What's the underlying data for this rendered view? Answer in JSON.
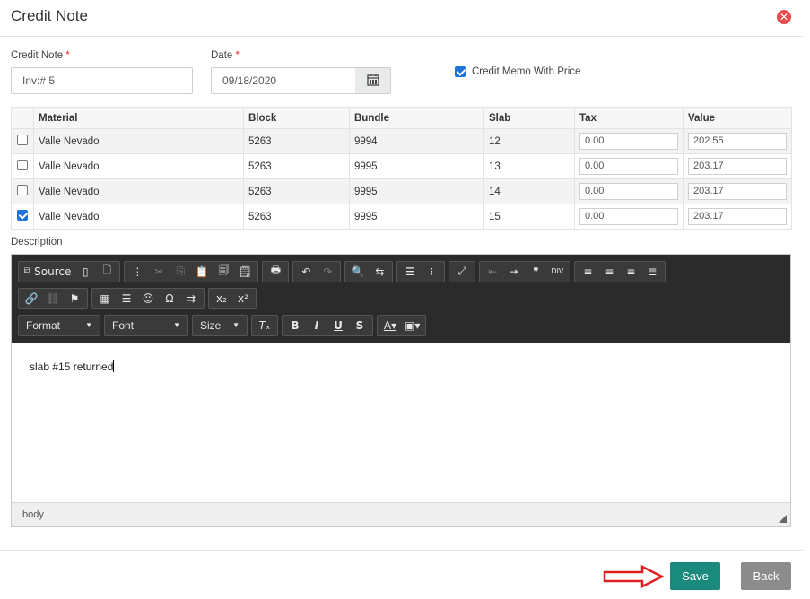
{
  "dialog": {
    "title": "Credit Note"
  },
  "form": {
    "credit_note_label": "Credit Note",
    "credit_note_value": "Inv:# 5",
    "date_label": "Date",
    "date_value": "09/18/2020",
    "required_mark": "*",
    "credit_memo_label": "Credit Memo With Price",
    "credit_memo_checked": true
  },
  "table": {
    "headers": [
      "Material",
      "Block",
      "Bundle",
      "Slab",
      "Tax",
      "Value"
    ],
    "rows": [
      {
        "checked": false,
        "material": "Valle Nevado",
        "block": "5263",
        "bundle": "9994",
        "slab": "12",
        "tax": "0.00",
        "value": "202.55"
      },
      {
        "checked": false,
        "material": "Valle Nevado",
        "block": "5263",
        "bundle": "9995",
        "slab": "13",
        "tax": "0.00",
        "value": "203.17"
      },
      {
        "checked": false,
        "material": "Valle Nevado",
        "block": "5263",
        "bundle": "9995",
        "slab": "14",
        "tax": "0.00",
        "value": "203.17"
      },
      {
        "checked": true,
        "material": "Valle Nevado",
        "block": "5263",
        "bundle": "9995",
        "slab": "15",
        "tax": "0.00",
        "value": "203.17"
      }
    ]
  },
  "description": {
    "label": "Description",
    "toolbar": {
      "source_label": "Source",
      "format_label": "Format",
      "font_label": "Font",
      "size_label": "Size"
    },
    "content": "slab #15 returned",
    "status_path": "body"
  },
  "footer": {
    "save_label": "Save",
    "back_label": "Back"
  },
  "colors": {
    "save": "#1a8a7c",
    "back": "#8c8c8c",
    "close": "#e84c4c",
    "arrow": "#e02020",
    "checkbox": "#1d74d8"
  }
}
